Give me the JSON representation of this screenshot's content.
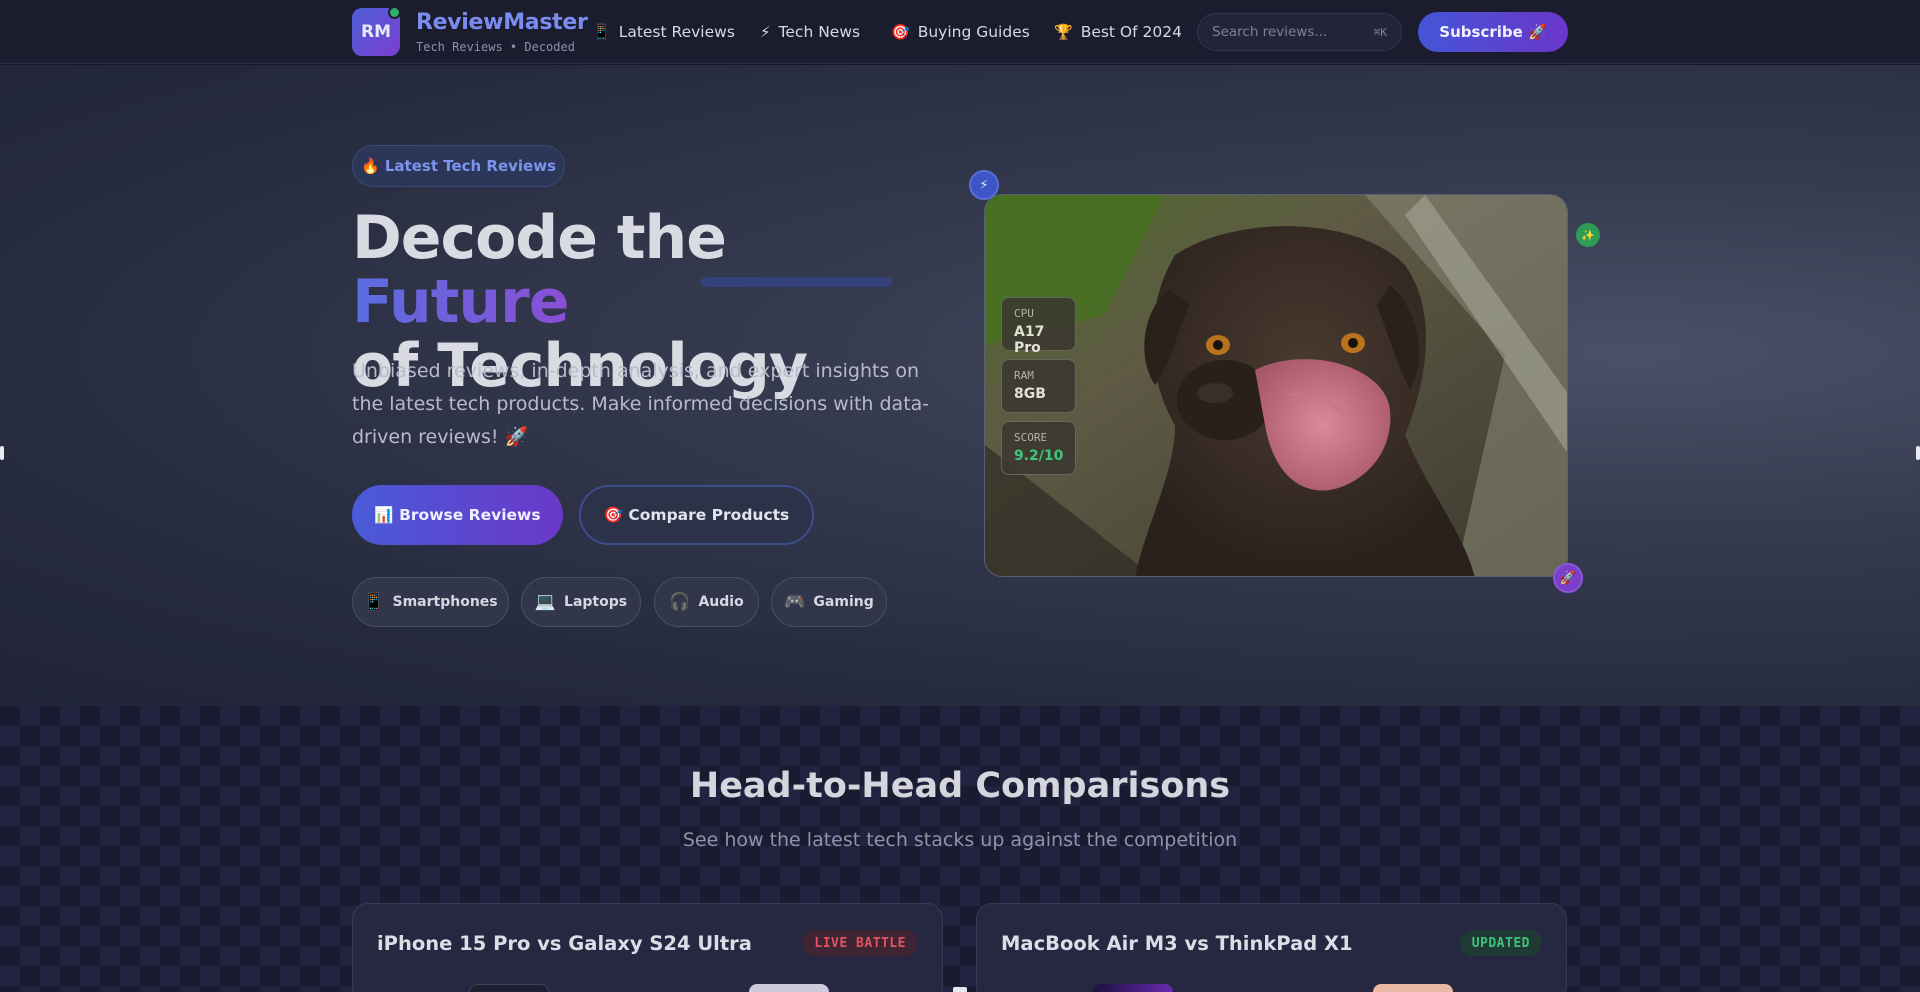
{
  "nav": {
    "logo_text": "RM",
    "brand_name": "ReviewMaster",
    "brand_tagline": "Tech Reviews • Decoded",
    "links": [
      {
        "icon": "📱",
        "icon_name": "phone-icon",
        "label": "Latest Reviews"
      },
      {
        "icon": "⚡",
        "icon_name": "lightning-icon",
        "label": "Tech News"
      },
      {
        "icon": "🎯",
        "icon_name": "target-icon",
        "label": "Buying Guides"
      },
      {
        "icon": "🏆",
        "icon_name": "trophy-icon",
        "label": "Best Of 2024"
      }
    ],
    "search_placeholder": "Search reviews...",
    "search_shortcut": "⌘K",
    "subscribe_label": "Subscribe 🚀"
  },
  "hero": {
    "badge": "🔥 Latest Tech Reviews",
    "title_part1": "Decode the ",
    "title_highlight": "Future",
    "title_part2": "of Technology",
    "description": "Unbiased reviews, in-depth analysis, and expert insights on the latest tech products. Make informed decisions with data-driven reviews! 🚀",
    "primary_button": "📊 Browse Reviews",
    "secondary_button": "🎯 Compare Products",
    "categories": [
      {
        "icon": "📱",
        "icon_name": "smartphone-icon",
        "label": "Smartphones"
      },
      {
        "icon": "💻",
        "icon_name": "laptop-icon",
        "label": "Laptops"
      },
      {
        "icon": "🎧",
        "icon_name": "headphones-icon",
        "label": "Audio"
      },
      {
        "icon": "🎮",
        "icon_name": "gamepad-icon",
        "label": "Gaming"
      }
    ],
    "specs": [
      {
        "label": "CPU",
        "value": "A17 Pro"
      },
      {
        "label": "RAM",
        "value": "8GB"
      },
      {
        "label": "SCORE",
        "value": "9.2/10"
      }
    ],
    "float_badges": {
      "top_left": "⚡",
      "top_right": "✨",
      "bottom_right": "🚀"
    }
  },
  "comparisons": {
    "title": "Head-to-Head Comparisons",
    "subtitle": "See how the latest tech stacks up against the competition",
    "cards": [
      {
        "title": "iPhone 15 Pro vs Galaxy S24 Ultra",
        "badge": "LIVE BATTLE"
      },
      {
        "title": "MacBook Air M3 vs ThinkPad X1",
        "badge": "UPDATED"
      }
    ]
  },
  "colors": {
    "accent_blue": "#4a5bd8",
    "accent_purple": "#6a38c8",
    "live_red": "#e0535f",
    "updated_green": "#3ec27a",
    "score_green": "#3fc77d"
  }
}
